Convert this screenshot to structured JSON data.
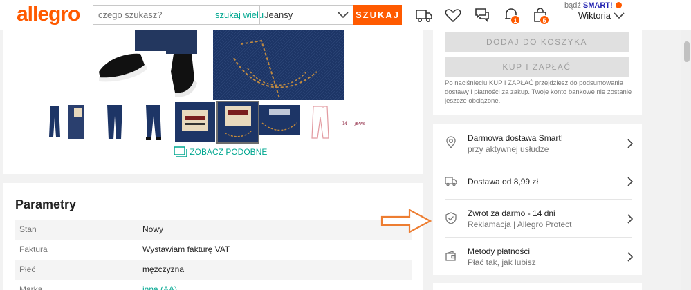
{
  "header": {
    "logo": "allegro",
    "search_placeholder": "czego szukasz?",
    "search_many": "szukaj wielu",
    "category": "Jeansy",
    "search_button": "SZUKAJ",
    "notifications_count": "1",
    "cart_count": "5",
    "smart_prefix": "bądź",
    "smart_brand": "SMART!",
    "user_name": "Wiktoria"
  },
  "gallery": {
    "see_similar": "ZOBACZ PODOBNE",
    "selected_thumb_index": 4
  },
  "params": {
    "title": "Parametry",
    "rows": [
      {
        "label": "Stan",
        "value": "Nowy"
      },
      {
        "label": "Faktura",
        "value": "Wystawiam fakturę VAT"
      },
      {
        "label": "Płeć",
        "value": "mężczyzna"
      },
      {
        "label": "Marka",
        "value": "inna (AA)"
      }
    ]
  },
  "buy": {
    "add_to_cart": "DODAJ DO KOSZYKA",
    "buy_and_pay": "KUP I ZAPŁAĆ",
    "note": "Po naciśnięciu KUP I ZAPŁAĆ przejdziesz do podsumowania dostawy i płatności za zakup. Twoje konto bankowe nie zostanie jeszcze obciążone."
  },
  "info": {
    "rows": [
      {
        "title": "Darmowa dostawa Smart!",
        "subtitle": "przy aktywnej usłudze",
        "icon": "smart-pin-icon"
      },
      {
        "title": "Dostawa od 8,99 zł",
        "subtitle": "",
        "icon": "truck-icon"
      },
      {
        "title": "Zwrot za darmo - 14 dni",
        "subtitle": "Reklamacja | Allegro Protect",
        "icon": "shield-icon"
      },
      {
        "title": "Metody płatności",
        "subtitle": "Płać tak, jak lubisz",
        "icon": "wallet-icon"
      }
    ]
  },
  "colors": {
    "brand": "#ff5a00",
    "link": "#00a790",
    "arrow": "#ed7d31"
  }
}
